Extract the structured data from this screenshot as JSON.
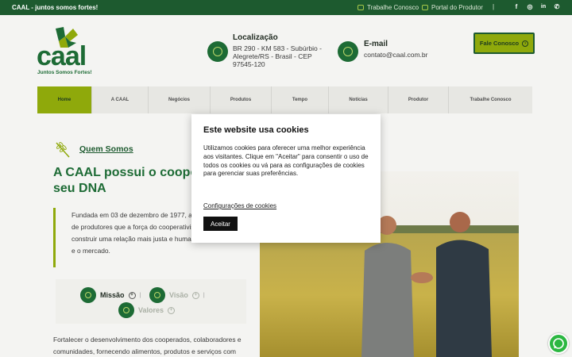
{
  "topbar": {
    "tagline": "CAAL - juntos somos fortes!",
    "links": [
      {
        "label": "Trabalhe Conosco",
        "icon": "briefcase-icon"
      },
      {
        "label": "Portal do Produtor",
        "icon": "tractor-icon"
      }
    ],
    "separator": "|",
    "social": [
      {
        "icon": "facebook-icon",
        "glyph": "f"
      },
      {
        "icon": "instagram-icon",
        "glyph": "◎"
      },
      {
        "icon": "linkedin-icon",
        "glyph": "in"
      },
      {
        "icon": "whatsapp-icon",
        "glyph": "✆"
      }
    ]
  },
  "header": {
    "logo_text": "caal",
    "logo_tagline": "Juntos Somos Fortes!",
    "location": {
      "title": "Localização",
      "text": "BR 290 - KM 583 - Subúrbio - Alegrete/RS - Brasil - CEP 97545-120"
    },
    "email": {
      "title": "E-mail",
      "text": "contato@caal.com.br"
    },
    "cta_label": "Fale Conosco"
  },
  "nav": {
    "items": [
      "Home",
      "A CAAL",
      "Negócios",
      "Produtos",
      "Tempo",
      "Notícias",
      "Produtor",
      "Trabalhe Conosco"
    ],
    "active_index": 0
  },
  "main": {
    "section_label": "Quem Somos",
    "headline": "A CAAL possui o cooperat no seu DNA",
    "quote": "Fundada em 03 de dezembro de 1977, a pa pioneira de um grupo de produtores que a força do cooperativismo e na sua capacio construir uma relação mais justa e humana entre o produtor rural e o mercado.",
    "tabs": [
      {
        "label": "Missão",
        "icon": "target-icon",
        "active": true
      },
      {
        "label": "Visão",
        "icon": "eye-icon",
        "active": false
      },
      {
        "label": "Valores",
        "icon": "heart-icon",
        "active": false
      }
    ],
    "tab_separator": "|",
    "body": "Fortalecer o desenvolvimento dos cooperados, colaboradores e comunidades, fornecendo alimentos, produtos e serviços com"
  },
  "cookie": {
    "title": "Este website usa cookies",
    "text": "Utilizamos cookies para oferecer uma melhor experiência aos visitantes. Clique em \"Aceitar\" para consentir o uso de todos os cookies ou vá para as configurações de cookies para gerenciar suas preferências.",
    "settings_link": "Configurações de cookies",
    "accept_label": "Aceitar"
  },
  "colors": {
    "brand_green": "#1d6b35",
    "dark_green": "#1d5a2f",
    "accent_lime": "#8fa90b",
    "whatsapp": "#2bb741"
  }
}
